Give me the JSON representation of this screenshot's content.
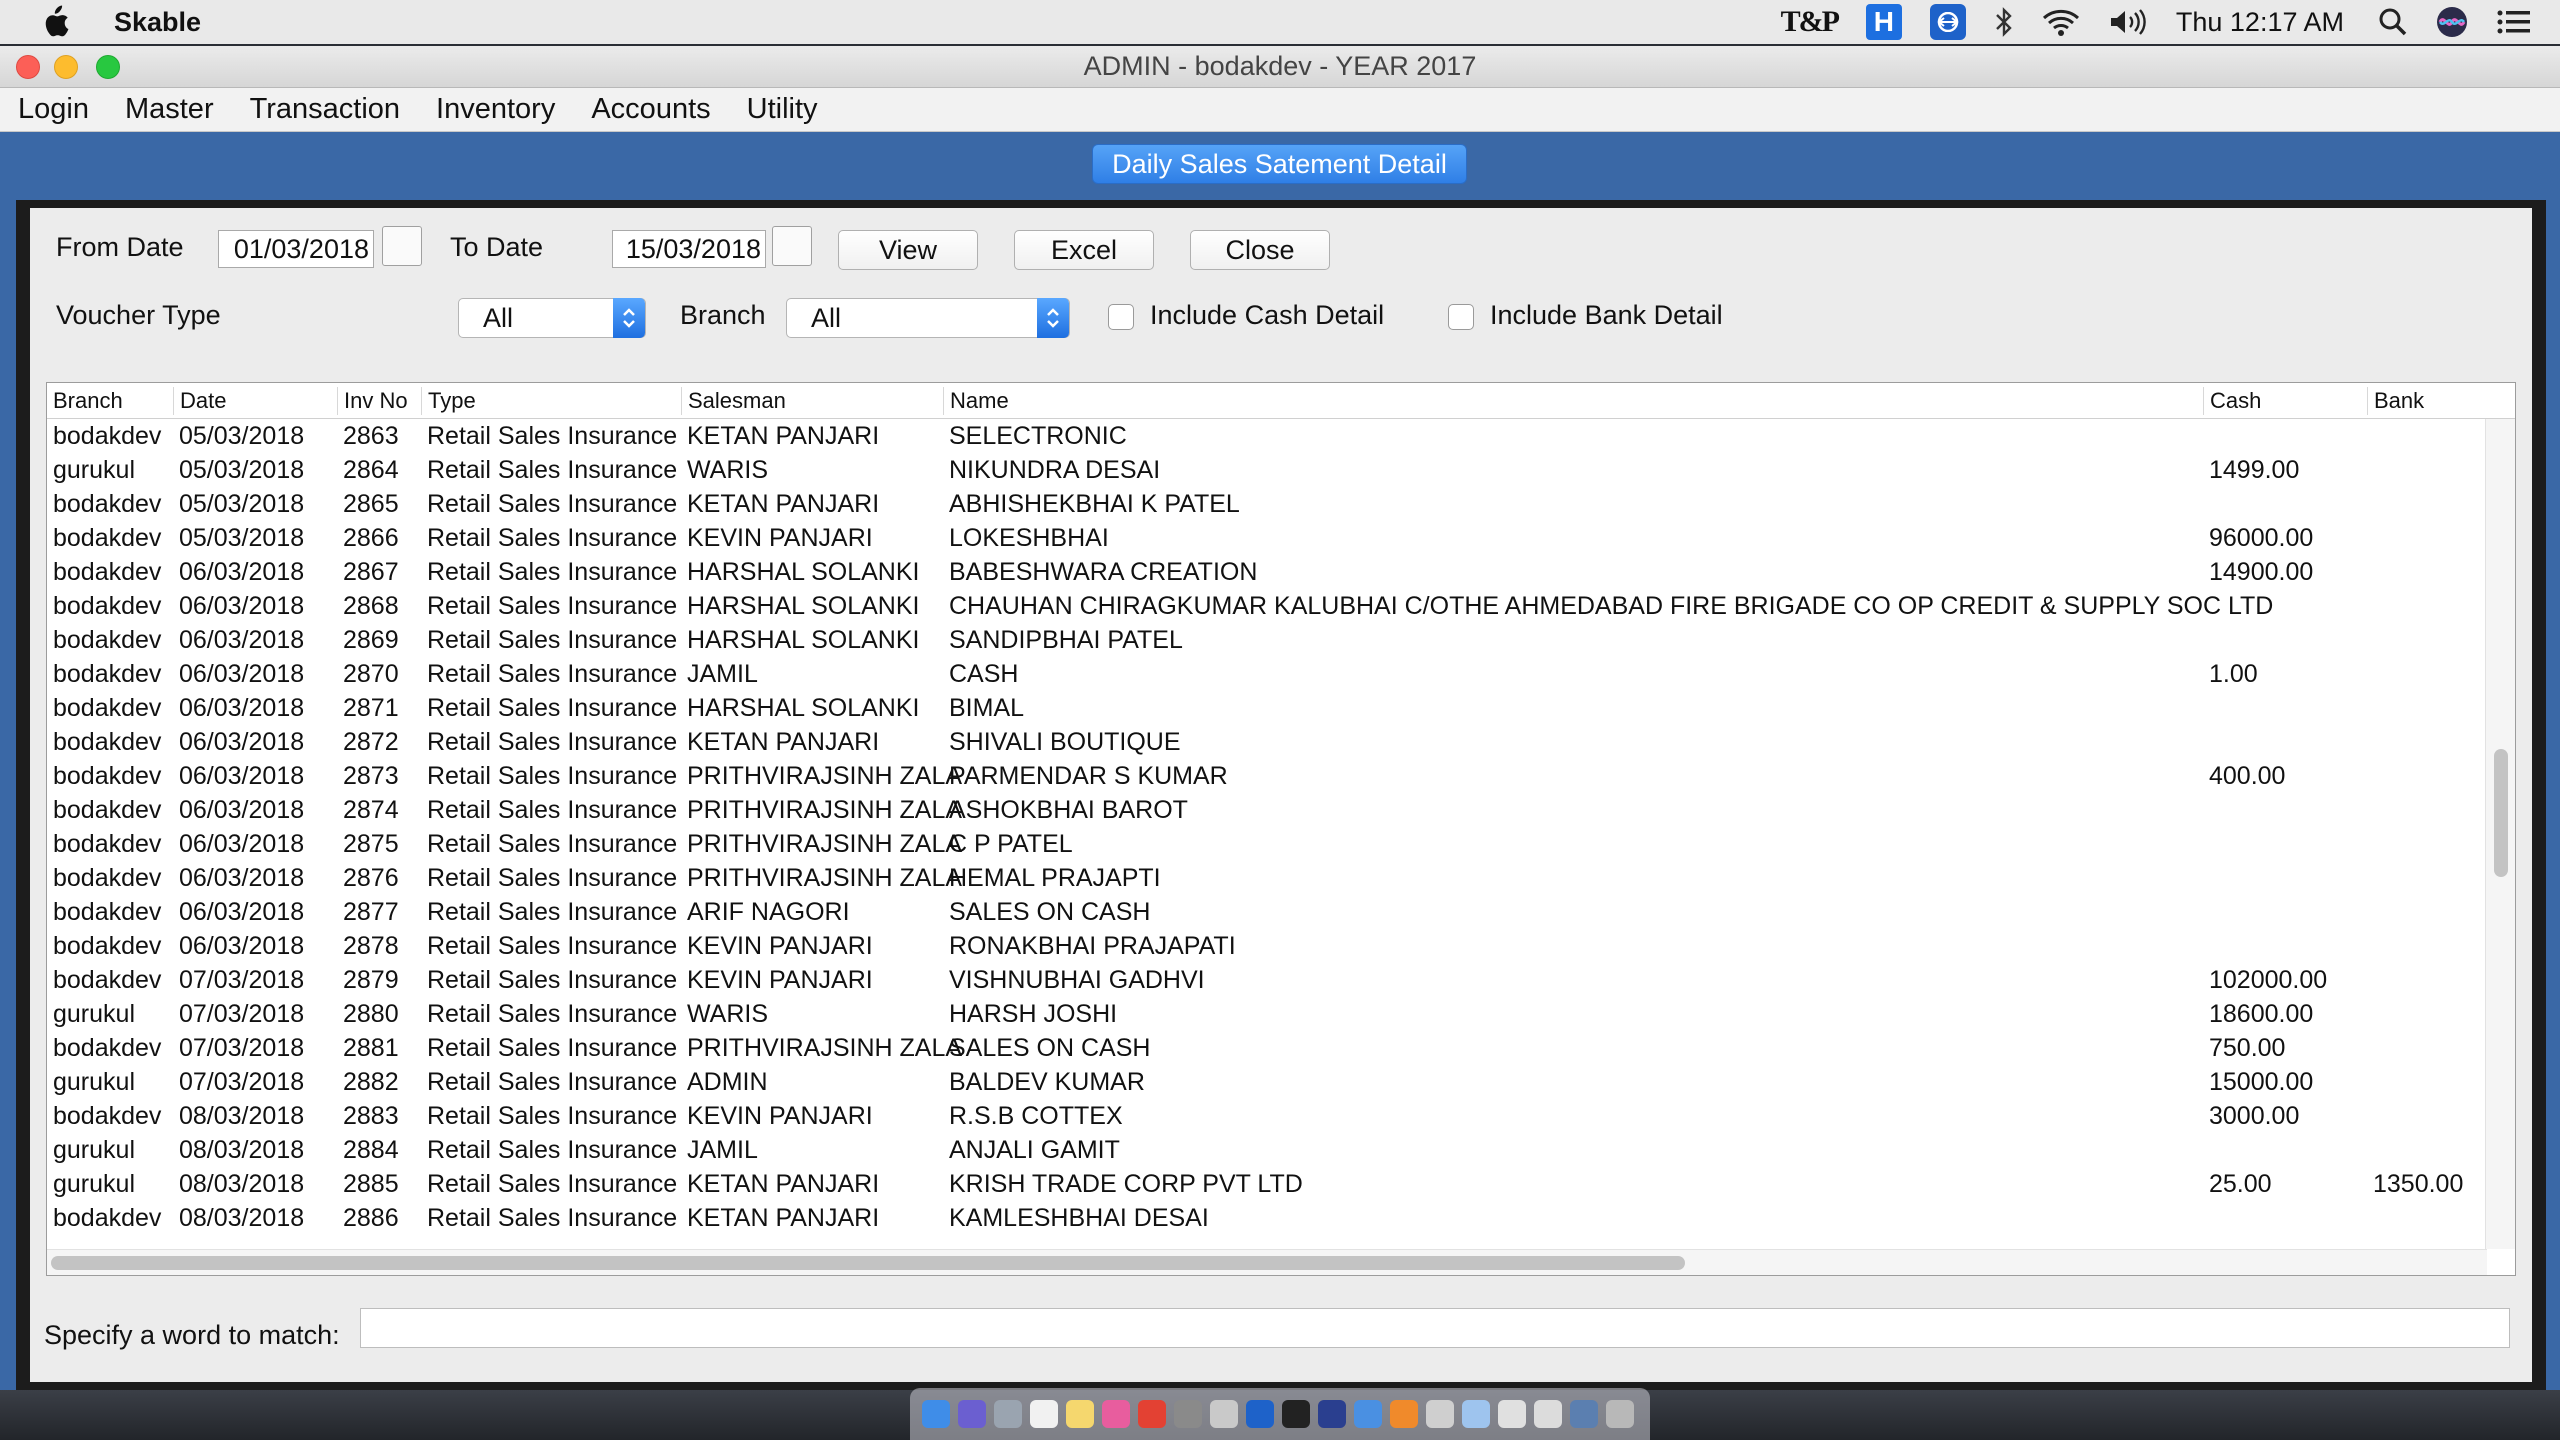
{
  "menubar": {
    "app_name": "Skable",
    "clock": "Thu 12:17 AM",
    "status_icons": [
      "tp-solutions-icon",
      "h-app-icon",
      "teamviewer-icon",
      "bluetooth-icon",
      "wifi-icon",
      "volume-icon",
      "search-icon",
      "siri-icon",
      "notification-list-icon"
    ],
    "tp_text": "T&P"
  },
  "window": {
    "title": "ADMIN - bodakdev - YEAR 2017",
    "menu": [
      "Login",
      "Master",
      "Transaction",
      "Inventory",
      "Accounts",
      "Utility"
    ]
  },
  "form": {
    "title": "Daily Sales Satement Detail",
    "from_label": "From Date",
    "from_value": "01/03/2018",
    "to_label": "To Date",
    "to_value": "15/03/2018",
    "view_label": "View",
    "excel_label": "Excel",
    "close_label": "Close",
    "voucher_label": "Voucher Type",
    "voucher_value": "All",
    "branch_label": "Branch",
    "branch_value": "All",
    "cash_detail_label": "Include Cash Detail",
    "bank_detail_label": "Include Bank Detail",
    "match_label": "Specify a word to match:",
    "match_value": ""
  },
  "table": {
    "columns": [
      "Branch",
      "Date",
      "Inv No",
      "Type",
      "Salesman",
      "Name",
      "Cash",
      "Bank"
    ],
    "rows": [
      [
        "bodakdev",
        "05/03/2018",
        "2863",
        "Retail Sales Insurance",
        "KETAN PANJARI",
        "SELECTRONIC",
        "",
        ""
      ],
      [
        "gurukul",
        "05/03/2018",
        "2864",
        "Retail Sales Insurance",
        "WARIS",
        "NIKUNDRA DESAI",
        "1499.00",
        ""
      ],
      [
        "bodakdev",
        "05/03/2018",
        "2865",
        "Retail Sales Insurance",
        "KETAN PANJARI",
        "ABHISHEKBHAI K PATEL",
        "",
        ""
      ],
      [
        "bodakdev",
        "05/03/2018",
        "2866",
        "Retail Sales Insurance",
        "KEVIN PANJARI",
        "LOKESHBHAI",
        "96000.00",
        ""
      ],
      [
        "bodakdev",
        "06/03/2018",
        "2867",
        "Retail Sales Insurance",
        "HARSHAL SOLANKI",
        "BABESHWARA CREATION",
        "14900.00",
        ""
      ],
      [
        "bodakdev",
        "06/03/2018",
        "2868",
        "Retail Sales Insurance",
        "HARSHAL SOLANKI",
        "CHAUHAN CHIRAGKUMAR KALUBHAI C/OTHE AHMEDABAD FIRE BRIGADE CO OP CREDIT & SUPPLY SOC LTD",
        "",
        ""
      ],
      [
        "bodakdev",
        "06/03/2018",
        "2869",
        "Retail Sales Insurance",
        "HARSHAL SOLANKI",
        "SANDIPBHAI PATEL",
        "",
        ""
      ],
      [
        "bodakdev",
        "06/03/2018",
        "2870",
        "Retail Sales Insurance",
        "JAMIL",
        "CASH",
        "1.00",
        ""
      ],
      [
        "bodakdev",
        "06/03/2018",
        "2871",
        "Retail Sales Insurance",
        "HARSHAL SOLANKI",
        "BIMAL",
        "",
        ""
      ],
      [
        "bodakdev",
        "06/03/2018",
        "2872",
        "Retail Sales Insurance",
        "KETAN PANJARI",
        "SHIVALI BOUTIQUE",
        "",
        ""
      ],
      [
        "bodakdev",
        "06/03/2018",
        "2873",
        "Retail Sales Insurance",
        "PRITHVIRAJSINH ZALA",
        "PARMENDAR S KUMAR",
        "400.00",
        ""
      ],
      [
        "bodakdev",
        "06/03/2018",
        "2874",
        "Retail Sales Insurance",
        "PRITHVIRAJSINH ZALA",
        "ASHOKBHAI BAROT",
        "",
        ""
      ],
      [
        "bodakdev",
        "06/03/2018",
        "2875",
        "Retail Sales Insurance",
        "PRITHVIRAJSINH ZALA",
        "C P PATEL",
        "",
        ""
      ],
      [
        "bodakdev",
        "06/03/2018",
        "2876",
        "Retail Sales Insurance",
        "PRITHVIRAJSINH ZALA",
        "HEMAL PRAJAPTI",
        "",
        ""
      ],
      [
        "bodakdev",
        "06/03/2018",
        "2877",
        "Retail Sales Insurance",
        "ARIF NAGORI",
        "SALES ON CASH",
        "",
        ""
      ],
      [
        "bodakdev",
        "06/03/2018",
        "2878",
        "Retail Sales Insurance",
        "KEVIN PANJARI",
        "RONAKBHAI PRAJAPATI",
        "",
        ""
      ],
      [
        "bodakdev",
        "07/03/2018",
        "2879",
        "Retail Sales Insurance",
        "KEVIN PANJARI",
        "VISHNUBHAI GADHVI",
        "102000.00",
        ""
      ],
      [
        "gurukul",
        "07/03/2018",
        "2880",
        "Retail Sales Insurance",
        "WARIS",
        "HARSH JOSHI",
        "18600.00",
        ""
      ],
      [
        "bodakdev",
        "07/03/2018",
        "2881",
        "Retail Sales Insurance",
        "PRITHVIRAJSINH ZALA",
        "SALES ON CASH",
        "750.00",
        ""
      ],
      [
        "gurukul",
        "07/03/2018",
        "2882",
        "Retail Sales Insurance",
        "ADMIN",
        "BALDEV KUMAR",
        "15000.00",
        ""
      ],
      [
        "bodakdev",
        "08/03/2018",
        "2883",
        "Retail Sales Insurance",
        "KEVIN PANJARI",
        "R.S.B COTTEX",
        "3000.00",
        ""
      ],
      [
        "gurukul",
        "08/03/2018",
        "2884",
        "Retail Sales Insurance",
        "JAMIL",
        "ANJALI GAMIT",
        "",
        ""
      ],
      [
        "gurukul",
        "08/03/2018",
        "2885",
        "Retail Sales Insurance",
        "KETAN PANJARI",
        "KRISH TRADE CORP PVT LTD",
        "25.00",
        "1350.00"
      ],
      [
        "bodakdev",
        "08/03/2018",
        "2886",
        "Retail Sales Insurance",
        "KETAN PANJARI",
        "KAMLESHBHAI DESAI",
        "",
        ""
      ]
    ]
  },
  "dock": {
    "icons": [
      "finder-icon",
      "siri-icon",
      "launchpad-icon",
      "calendar-icon",
      "notes-icon",
      "itunes-icon",
      "chrome-icon",
      "system-preferences-icon",
      "script-editor-icon",
      "teamviewer-icon",
      "terminal-icon",
      "app-icon",
      "maps-icon",
      "pencil-app-icon",
      "installer-icon",
      "box-icon",
      "java-icon",
      "preview-icon",
      "screen-icon",
      "trash-icon"
    ],
    "colors": [
      "#3f8de8",
      "#6b5fd0",
      "#9aa4b0",
      "#f1f1f1",
      "#f5d76e",
      "#e85d9e",
      "#e34133",
      "#8a8a8a",
      "#c9c9c9",
      "#1e62c9",
      "#222222",
      "#2a3f8f",
      "#4a90e2",
      "#f08a2b",
      "#cfcfcf",
      "#9ec4ee",
      "#e0e0e0",
      "#dcdcdc",
      "#5b7fb0",
      "#b8b8b8"
    ]
  }
}
